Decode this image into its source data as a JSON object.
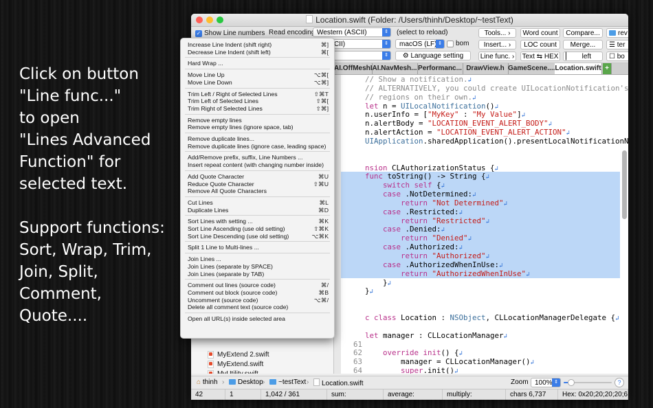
{
  "promo": {
    "paragraph1": [
      "Click on button",
      "\"Line func...\"",
      "to open",
      "\"Lines Advanced",
      "Function\" for",
      "selected text."
    ],
    "paragraph2": [
      "Support functions:",
      "Sort, Wrap, Trim,",
      "Join, Split,",
      "Comment,",
      "Quote...."
    ]
  },
  "window": {
    "title": "Location.swift (Folder: /Users/thinh/Desktop/~testText)",
    "lights": {
      "close": "#fe5f57",
      "minimize": "#febc2e",
      "zoom": "#28c840"
    }
  },
  "toolbar": {
    "show_line_numbers": "Show Line numbers",
    "read_encoding_label": "Read encoding",
    "read_encoding_value": "Western (ASCII)",
    "select_to_reload": "(select to reload)",
    "write_encoding_value": "n (ASCII)",
    "line_ending_value": "macOS (LF)",
    "bom_label": "bom",
    "language_setting": "Language setting",
    "buttons": {
      "tools": "Tools...",
      "word_count": "Word count",
      "compare": "Compare...",
      "rev": "rev",
      "insert": "Insert...",
      "loc_count": "LOC count",
      "merge": "Merge...",
      "ter": "ter",
      "line_func": "Line func.",
      "text_hex": "Text ⇆ HEX",
      "left": "left",
      "bo": "bo"
    }
  },
  "tabs": [
    {
      "label": "AI.OffMeshL...",
      "active": false
    },
    {
      "label": "AI.NavMesh...",
      "active": false
    },
    {
      "label": "Performanc...",
      "active": false
    },
    {
      "label": "DrawView.h",
      "active": false
    },
    {
      "label": "GameScene....",
      "active": false
    },
    {
      "label": "Location.swift",
      "active": true
    }
  ],
  "tab_add": "+",
  "code_lines": [
    {
      "num": "",
      "hl": false,
      "tokens": [
        [
          "cm",
          "// Show a notification."
        ]
      ]
    },
    {
      "num": "",
      "hl": false,
      "tokens": [
        [
          "cm",
          "// ALTERNATIVELY, you could create UILocationNotification's set to mo"
        ]
      ]
    },
    {
      "num": "",
      "hl": false,
      "tokens": [
        [
          "cm",
          "// regions on their own."
        ]
      ]
    },
    {
      "num": "",
      "hl": false,
      "tokens": [
        [
          "kw",
          "let"
        ],
        [
          "",
          " n = "
        ],
        [
          "ty",
          "UILocalNotification"
        ],
        [
          "",
          "()"
        ]
      ]
    },
    {
      "num": "",
      "hl": false,
      "tokens": [
        [
          "",
          "n.userInfo = ["
        ],
        [
          "str",
          "\"MyKey\""
        ],
        [
          "",
          " : "
        ],
        [
          "str",
          "\"My Value\""
        ],
        [
          "",
          "]"
        ]
      ]
    },
    {
      "num": "",
      "hl": false,
      "tokens": [
        [
          "",
          "n.alertBody = "
        ],
        [
          "str",
          "\"LOCATION_EVENT_ALERT_BODY\""
        ]
      ]
    },
    {
      "num": "",
      "hl": false,
      "tokens": [
        [
          "",
          "n.alertAction = "
        ],
        [
          "str",
          "\"LOCATION_EVENT_ALERT_ACTION\""
        ]
      ]
    },
    {
      "num": "",
      "hl": false,
      "tokens": [
        [
          "ty",
          "UIApplication"
        ],
        [
          "",
          ".sharedApplication().presentLocalNotificationNow(n)"
        ]
      ]
    },
    {
      "num": "",
      "hl": false,
      "tokens": [
        [
          "",
          ""
        ]
      ]
    },
    {
      "num": "",
      "hl": false,
      "tokens": [
        [
          "",
          ""
        ]
      ]
    },
    {
      "num": "",
      "hl": false,
      "tokens": [
        [
          "kw",
          "nsion"
        ],
        [
          "",
          " CLAuthorizationStatus {"
        ]
      ]
    },
    {
      "num": "",
      "hl": true,
      "tokens": [
        [
          "kw",
          "func"
        ],
        [
          "",
          " toString() -> String {"
        ]
      ]
    },
    {
      "num": "",
      "hl": true,
      "tokens": [
        [
          "",
          "    "
        ],
        [
          "kw",
          "switch self"
        ],
        [
          "",
          " {"
        ]
      ]
    },
    {
      "num": "",
      "hl": true,
      "tokens": [
        [
          "",
          "    "
        ],
        [
          "kw",
          "case"
        ],
        [
          "",
          " .NotDetermined:"
        ]
      ]
    },
    {
      "num": "",
      "hl": true,
      "tokens": [
        [
          "",
          "        "
        ],
        [
          "kw",
          "return"
        ],
        [
          "",
          " "
        ],
        [
          "str",
          "\"Not Determined\""
        ]
      ]
    },
    {
      "num": "",
      "hl": true,
      "tokens": [
        [
          "",
          "    "
        ],
        [
          "kw",
          "case"
        ],
        [
          "",
          " .Restricted:"
        ]
      ]
    },
    {
      "num": "",
      "hl": true,
      "tokens": [
        [
          "",
          "        "
        ],
        [
          "kw",
          "return"
        ],
        [
          "",
          " "
        ],
        [
          "str",
          "\"Restricted\""
        ]
      ]
    },
    {
      "num": "",
      "hl": true,
      "tokens": [
        [
          "",
          "    "
        ],
        [
          "kw",
          "case"
        ],
        [
          "",
          " .Denied:"
        ]
      ]
    },
    {
      "num": "",
      "hl": true,
      "tokens": [
        [
          "",
          "        "
        ],
        [
          "kw",
          "return"
        ],
        [
          "",
          " "
        ],
        [
          "str",
          "\"Denied\""
        ]
      ]
    },
    {
      "num": "",
      "hl": true,
      "tokens": [
        [
          "",
          "    "
        ],
        [
          "kw",
          "case"
        ],
        [
          "",
          " .Authorized:"
        ]
      ]
    },
    {
      "num": "",
      "hl": true,
      "tokens": [
        [
          "",
          "        "
        ],
        [
          "kw",
          "return"
        ],
        [
          "",
          " "
        ],
        [
          "str",
          "\"Authorized\""
        ]
      ]
    },
    {
      "num": "",
      "hl": true,
      "tokens": [
        [
          "",
          "    "
        ],
        [
          "kw",
          "case"
        ],
        [
          "",
          " .AuthorizedWhenInUse:"
        ]
      ]
    },
    {
      "num": "",
      "hl": true,
      "tokens": [
        [
          "",
          "        "
        ],
        [
          "kw",
          "return"
        ],
        [
          "",
          " "
        ],
        [
          "str",
          "\"AuthorizedWhenInUse\""
        ]
      ]
    },
    {
      "num": "",
      "hl": false,
      "tokens": [
        [
          "",
          "    }"
        ]
      ]
    },
    {
      "num": "",
      "hl": false,
      "tokens": [
        [
          "",
          "}"
        ]
      ]
    },
    {
      "num": "",
      "hl": false,
      "tokens": [
        [
          "",
          ""
        ]
      ]
    },
    {
      "num": "",
      "hl": false,
      "tokens": [
        [
          "",
          ""
        ]
      ]
    },
    {
      "num": "",
      "hl": false,
      "tokens": [
        [
          "kw",
          "c class"
        ],
        [
          "",
          " Location : "
        ],
        [
          "ty",
          "NSObject"
        ],
        [
          "",
          ", CLLocationManagerDelegate {"
        ]
      ]
    },
    {
      "num": "",
      "hl": false,
      "tokens": [
        [
          "",
          ""
        ]
      ]
    },
    {
      "num": "",
      "hl": false,
      "tokens": [
        [
          "kw",
          "let"
        ],
        [
          "",
          " manager : CLLocationManager"
        ]
      ]
    },
    {
      "num": "61",
      "hl": false,
      "tokens": [
        [
          "",
          ""
        ]
      ]
    },
    {
      "num": "62",
      "hl": false,
      "tokens": [
        [
          "",
          "    "
        ],
        [
          "kw",
          "override init"
        ],
        [
          "",
          "() {"
        ]
      ]
    },
    {
      "num": "63",
      "hl": false,
      "tokens": [
        [
          "",
          "        manager = CLLocationManager()"
        ]
      ]
    },
    {
      "num": "64",
      "hl": false,
      "tokens": [
        [
          "",
          "        "
        ],
        [
          "kw",
          "super"
        ],
        [
          "",
          ".init()"
        ]
      ]
    }
  ],
  "sidebar_files": [
    "MyExtend 2.swift",
    "MyExtend.swift",
    "MyUtility.swift"
  ],
  "pathbar": {
    "user": "thinh",
    "desktop": "Desktop",
    "folder": "~testText",
    "file": "Location.swift",
    "zoom_label": "Zoom",
    "zoom_value": "100%",
    "zoom_level": 0.15,
    "help": "?"
  },
  "statusbar": [
    "42",
    "1",
    "1,042 / 361",
    "sum:",
    "average:",
    "multiply:",
    "chars 6,737",
    "Hex: 0x20;20;20;20;66"
  ],
  "menu_groups": [
    [
      [
        "Increase Line Indent (shift right)",
        "⌘]"
      ],
      [
        "Decrease Line Indent (shift left)",
        "⌘["
      ]
    ],
    [
      [
        "Hard Wrap ...",
        ""
      ]
    ],
    [
      [
        "Move Line Up",
        "⌥⌘["
      ],
      [
        "Move Line Down",
        "⌥⌘]"
      ]
    ],
    [
      [
        "Trim Left / Right of Selected Lines",
        "⇧⌘T"
      ],
      [
        "Trim Left of Selected Lines",
        "⇧⌘["
      ],
      [
        "Trim Right of Selected Lines",
        "⇧⌘]"
      ]
    ],
    [
      [
        "Remove empty lines",
        ""
      ],
      [
        "Remove empty lines (ignore space, tab)",
        ""
      ]
    ],
    [
      [
        "Remove duplicate lines...",
        ""
      ],
      [
        "Remove duplicate lines (ignore case, leading space)",
        ""
      ]
    ],
    [
      [
        "Add/Remove prefix, suffix, Line Numbers ...",
        ""
      ],
      [
        "Insert repeat content (with changing number inside)",
        ""
      ]
    ],
    [
      [
        "Add Quote Character",
        "⌘U"
      ],
      [
        "Reduce Quote Character",
        "⇧⌘U"
      ],
      [
        "Remove All Quote Characters",
        ""
      ]
    ],
    [
      [
        "Cut Lines",
        "⌘L"
      ],
      [
        "Duplicate Lines",
        "⌘D"
      ]
    ],
    [
      [
        "Sort Lines with setting ...",
        "⌘K"
      ],
      [
        "Sort Line Ascending (use old setting)",
        "⇧⌘K"
      ],
      [
        "Sort Line Descending (use old setting)",
        "⌥⌘K"
      ]
    ],
    [
      [
        "Split 1 Line to Multi-lines ...",
        ""
      ]
    ],
    [
      [
        "Join Lines ...",
        ""
      ],
      [
        "Join Lines (separate by SPACE)",
        ""
      ],
      [
        "Join Lines (separate by TAB)",
        ""
      ]
    ],
    [
      [
        "Comment out lines (source code)",
        "⌘/"
      ],
      [
        "Comment out block (source code)",
        "⌘B"
      ],
      [
        "Uncomment (source code)",
        "⌥⌘/"
      ],
      [
        "Delete all comment text (source code)",
        ""
      ]
    ],
    [
      [
        "Open all URL(s) inside selected area",
        ""
      ]
    ]
  ],
  "colors": {
    "accent": "#3b7de8",
    "selection": "#bcd7f7",
    "keyword": "#b8308a",
    "string": "#c41a16",
    "comment": "#8a8a8a"
  }
}
